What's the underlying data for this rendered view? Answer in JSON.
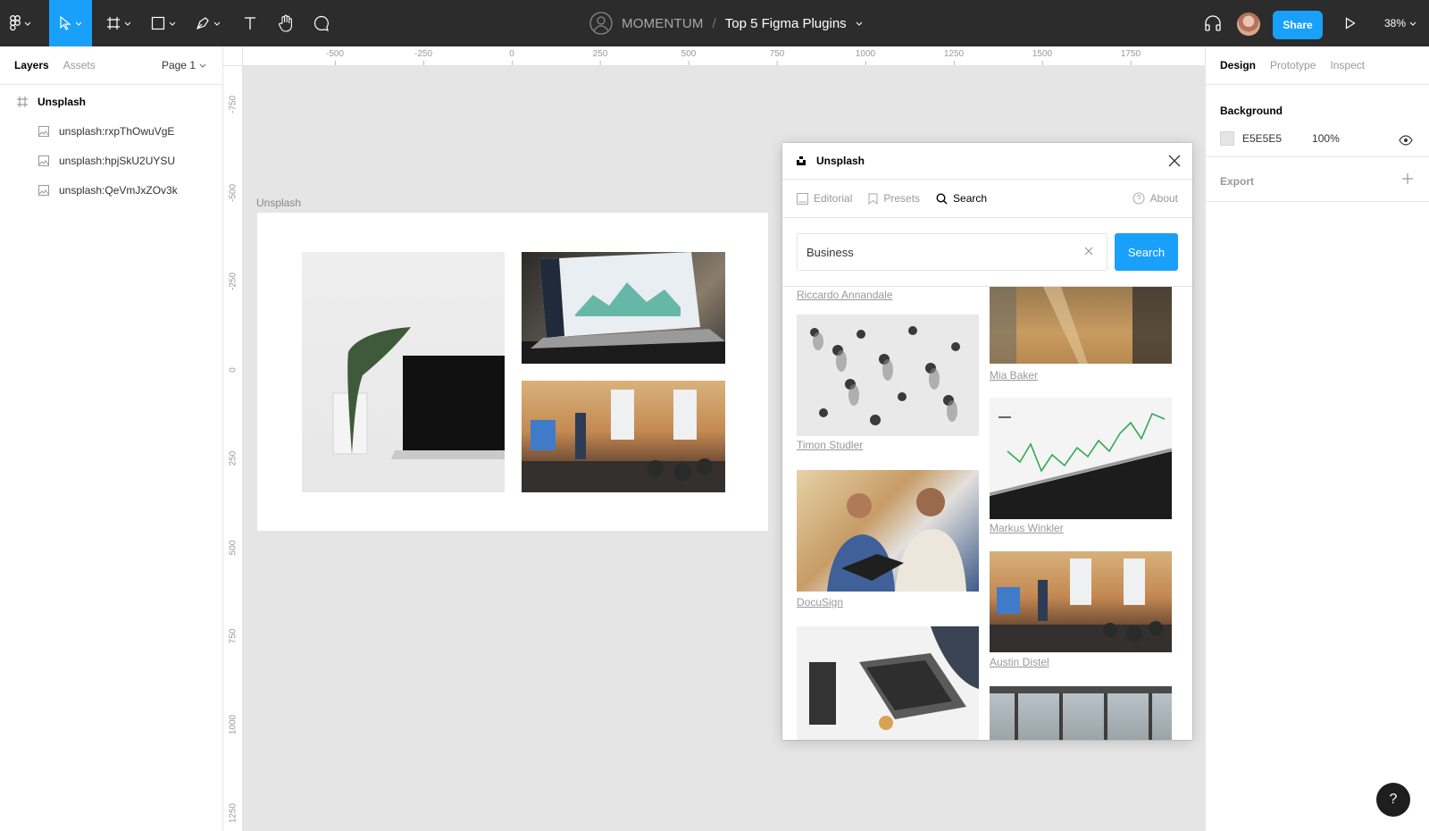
{
  "toolbar": {
    "team": "MOMENTUM",
    "separator": "/",
    "file_name": "Top 5 Figma Plugins",
    "share_label": "Share",
    "zoom": "38%"
  },
  "left_panel": {
    "tabs": [
      "Layers",
      "Assets"
    ],
    "page": "Page 1",
    "frame_layer": "Unsplash",
    "layers": [
      "unsplash:rxpThOwuVgE",
      "unsplash:hpjSkU2UYSU",
      "unsplash:QeVmJxZOv3k"
    ]
  },
  "right_panel": {
    "tabs": [
      "Design",
      "Prototype",
      "Inspect"
    ],
    "background_title": "Background",
    "background_hex": "E5E5E5",
    "background_opacity": "100%",
    "export_title": "Export"
  },
  "canvas": {
    "frame_label": "Unsplash",
    "ruler_h": [
      "-500",
      "-250",
      "0",
      "250",
      "500",
      "750",
      "1000",
      "1250",
      "1500",
      "1750"
    ],
    "ruler_v": [
      "-750",
      "-500",
      "-250",
      "0",
      "250",
      "500",
      "750",
      "1000",
      "1250"
    ]
  },
  "plugin": {
    "title": "Unsplash",
    "tabs": [
      "Editorial",
      "Presets",
      "Search"
    ],
    "about": "About",
    "search_value": "Business",
    "search_button": "Search",
    "captions": [
      "Riccardo Annandale",
      "Mia Baker",
      "Timon Studler",
      "Markus Winkler",
      "DocuSign",
      "Austin Distel"
    ]
  },
  "help_label": "?",
  "colors": {
    "toolbar_bg": "#2c2c2c",
    "accent": "#18a0fb",
    "canvas_bg": "#e5e5e5"
  }
}
